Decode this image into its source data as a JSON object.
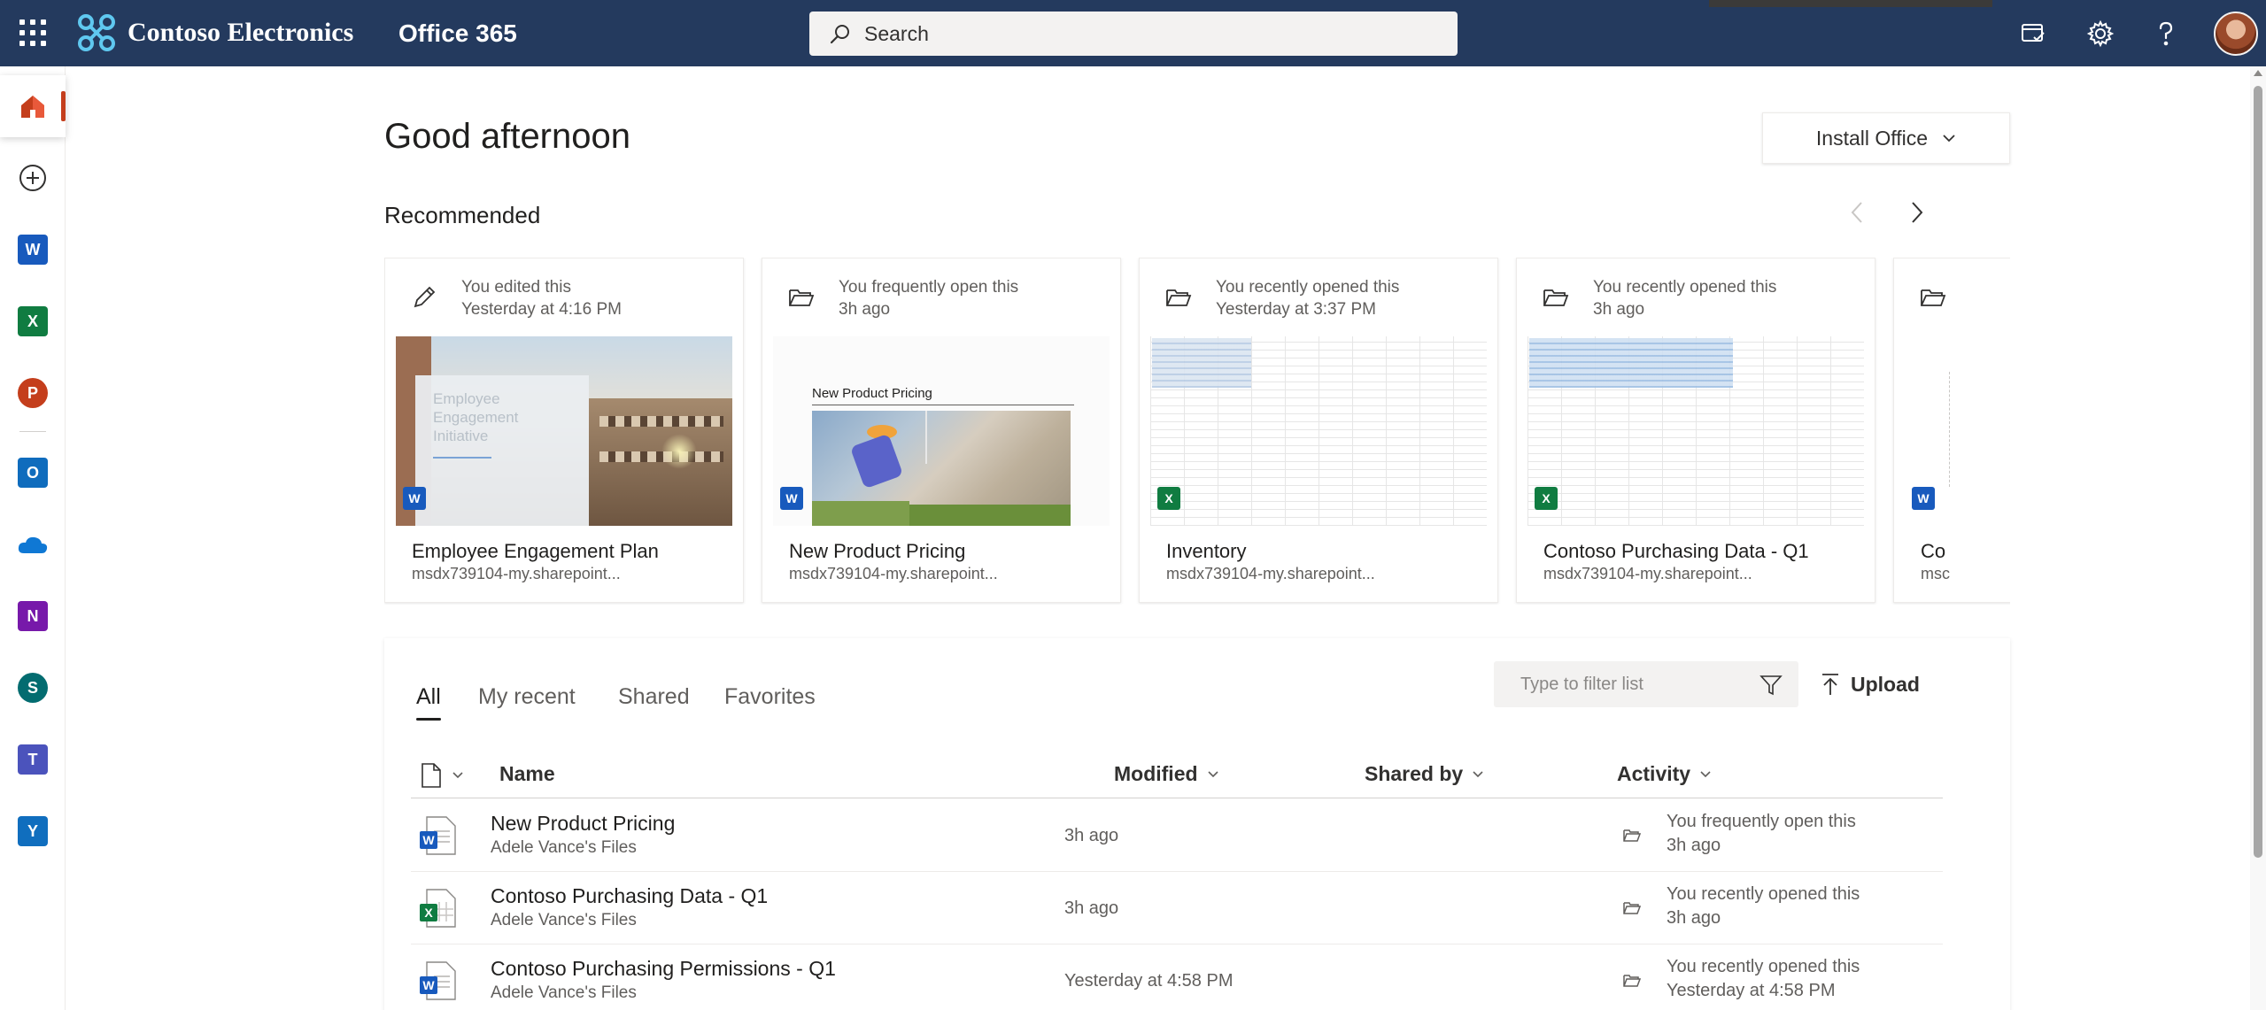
{
  "topbar": {
    "brand_name": "Contoso Electronics",
    "app_name": "Office 365",
    "search_placeholder": "Search"
  },
  "rail": {
    "apps": [
      {
        "name": "Word",
        "letter": "W",
        "color": "#185abd"
      },
      {
        "name": "Excel",
        "letter": "X",
        "color": "#107c41"
      },
      {
        "name": "PowerPoint",
        "letter": "P",
        "color": "#c43e1c"
      },
      {
        "name": "Outlook",
        "letter": "O",
        "color": "#0f6cbd"
      },
      {
        "name": "OneDrive",
        "letter": "",
        "color": "#0f78d4"
      },
      {
        "name": "OneNote",
        "letter": "N",
        "color": "#7719aa"
      },
      {
        "name": "SharePoint",
        "letter": "S",
        "color": "#036c70"
      },
      {
        "name": "Teams",
        "letter": "T",
        "color": "#4b53bc"
      },
      {
        "name": "Yammer",
        "letter": "Y",
        "color": "#106ebe"
      }
    ]
  },
  "main": {
    "greeting": "Good afternoon",
    "install_label": "Install Office",
    "recommended_title": "Recommended"
  },
  "cards": [
    {
      "activity": "You edited this",
      "time": "Yesterday at 4:16 PM",
      "name": "Employee Engagement Plan",
      "location": "msdx739104-my.sharepoint...",
      "app": "W",
      "icon": "pencil-icon",
      "thumb": "photo",
      "thumb_text": [
        "Employee",
        "Engagement",
        "Initiative"
      ]
    },
    {
      "activity": "You frequently open this",
      "time": "3h ago",
      "name": "New Product Pricing",
      "location": "msdx739104-my.sharepoint...",
      "app": "W",
      "icon": "folder-open-icon",
      "thumb": "doc",
      "thumb_text": [
        "New Product Pricing"
      ]
    },
    {
      "activity": "You recently opened this",
      "time": "Yesterday at 3:37 PM",
      "name": "Inventory",
      "location": "msdx739104-my.sharepoint...",
      "app": "X",
      "icon": "folder-open-icon",
      "thumb": "sheet",
      "thumb_text": []
    },
    {
      "activity": "You recently opened this",
      "time": "3h ago",
      "name": "Contoso Purchasing Data - Q1",
      "location": "msdx739104-my.sharepoint...",
      "app": "X",
      "icon": "folder-open-icon",
      "thumb": "sheet",
      "thumb_text": []
    },
    {
      "activity": "",
      "time": "",
      "name": "Co",
      "location": "msc",
      "app": "W",
      "icon": "folder-open-icon",
      "thumb": "blank",
      "thumb_text": []
    }
  ],
  "files": {
    "tabs": [
      "All",
      "My recent",
      "Shared",
      "Favorites"
    ],
    "filter_placeholder": "Type to filter list",
    "upload_label": "Upload",
    "columns": {
      "name": "Name",
      "modified": "Modified",
      "shared_by": "Shared by",
      "activity": "Activity"
    },
    "rows": [
      {
        "name": "New Product Pricing",
        "location": "Adele Vance's Files",
        "modified": "3h ago",
        "activity": "You frequently open this",
        "activity_time": "3h ago",
        "app": "W"
      },
      {
        "name": "Contoso Purchasing Data - Q1",
        "location": "Adele Vance's Files",
        "modified": "3h ago",
        "activity": "You recently opened this",
        "activity_time": "3h ago",
        "app": "X"
      },
      {
        "name": "Contoso Purchasing Permissions - Q1",
        "location": "Adele Vance's Files",
        "modified": "Yesterday at 4:58 PM",
        "activity": "You recently opened this",
        "activity_time": "Yesterday at 4:58 PM",
        "app": "W"
      }
    ]
  },
  "colors": {
    "topbar": "#243a5e",
    "word": "#185abd",
    "excel": "#107c41",
    "accent": "#c43e1c"
  }
}
